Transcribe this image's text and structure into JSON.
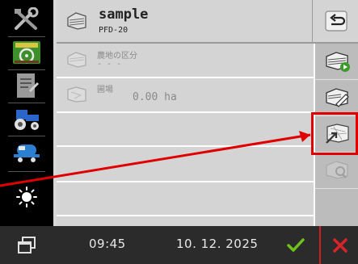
{
  "header": {
    "title": "sample",
    "subtitle": "PFD-20",
    "icon": "field-document-icon",
    "back_icon": "return-arrow-icon"
  },
  "sidebar": {
    "items": [
      {
        "icon": "tools-icon"
      },
      {
        "icon": "tractor-dashboard-icon"
      },
      {
        "icon": "field-notes-icon"
      },
      {
        "icon": "tractor-icon"
      },
      {
        "icon": "implement-icon"
      },
      {
        "icon": "brightness-icon"
      }
    ]
  },
  "main": {
    "rows": [
      {
        "label": "農地の区分",
        "value": "- - -",
        "icon": "field-category-icon"
      },
      {
        "label": "圃場",
        "value": "0.00 ha",
        "icon": "field-map-icon"
      }
    ]
  },
  "toolbar": {
    "items": [
      {
        "icon": "field-play-icon",
        "enabled": true
      },
      {
        "icon": "field-edit-icon",
        "enabled": true
      },
      {
        "icon": "field-import-icon",
        "enabled": true,
        "highlighted": true
      },
      {
        "icon": "field-search-icon",
        "enabled": false
      }
    ]
  },
  "status_bar": {
    "time": "09:45",
    "date": "10. 12. 2025",
    "confirm_icon": "checkmark-icon",
    "cancel_icon": "close-x-icon",
    "window_icon": "window-switch-icon"
  },
  "colors": {
    "accent_red": "#e00000",
    "confirm_green": "#6ec21b",
    "cancel_red": "#d8232a",
    "panel_gray": "#d4d4d4"
  }
}
